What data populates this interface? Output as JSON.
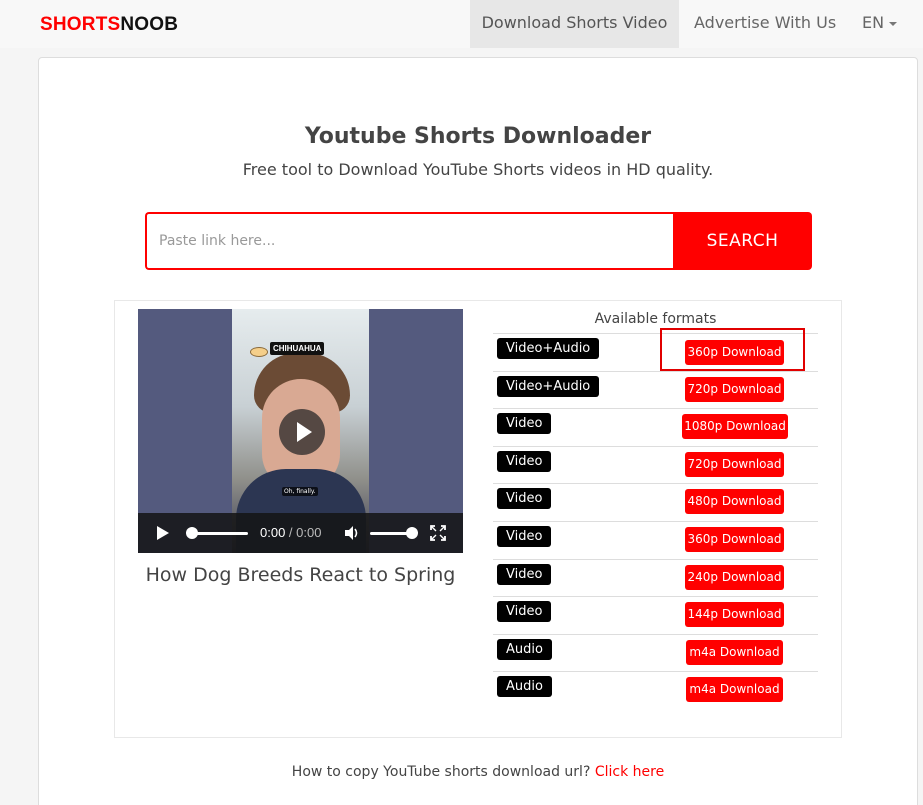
{
  "header": {
    "logo_part1": "SHORTS",
    "logo_part2": "NOOB",
    "nav": [
      {
        "label": "Download Shorts Video"
      },
      {
        "label": "Advertise With Us"
      },
      {
        "label": "EN"
      }
    ]
  },
  "hero": {
    "title": "Youtube Shorts Downloader",
    "subtitle": "Free tool to Download YouTube Shorts videos in HD quality."
  },
  "search": {
    "placeholder": "Paste link here...",
    "value": "",
    "button_label": "SEARCH"
  },
  "video": {
    "title": "How Dog Breeds React to Spring",
    "overlay_tag": "CHIHUAHUA",
    "overlay_caption": "Oh, finally.",
    "time_current": "0:00",
    "time_sep": " / ",
    "time_total": "0:00",
    "progress": 0,
    "volume": 1
  },
  "formats": {
    "heading": "Available formats",
    "rows": [
      {
        "type": "Video+Audio",
        "button": "360p Download"
      },
      {
        "type": "Video+Audio",
        "button": "720p Download"
      },
      {
        "type": "Video",
        "button": "1080p Download"
      },
      {
        "type": "Video",
        "button": "720p Download"
      },
      {
        "type": "Video",
        "button": "480p Download"
      },
      {
        "type": "Video",
        "button": "360p Download"
      },
      {
        "type": "Video",
        "button": "240p Download"
      },
      {
        "type": "Video",
        "button": "144p Download"
      },
      {
        "type": "Audio",
        "button": "m4a Download"
      },
      {
        "type": "Audio",
        "button": "m4a Download"
      }
    ]
  },
  "help": {
    "text": "How to copy YouTube shorts download url? ",
    "link": "Click here"
  },
  "colors": {
    "accent": "#ff0000",
    "label_bg": "#000000"
  }
}
